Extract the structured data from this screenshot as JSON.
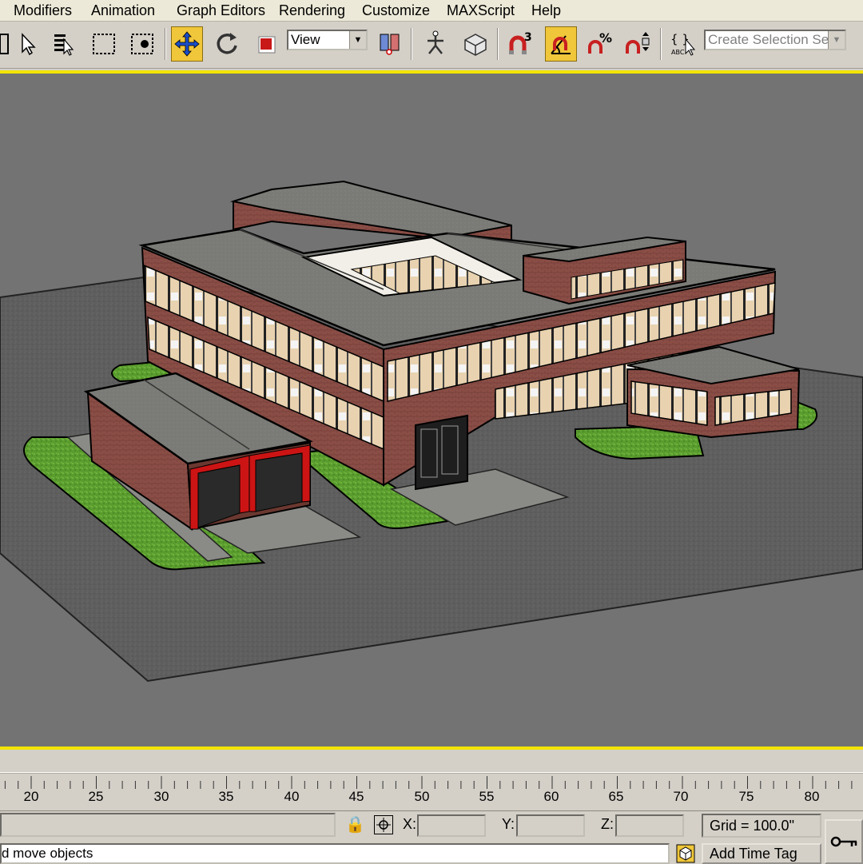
{
  "menu": {
    "items": [
      "Modifiers",
      "Animation",
      "Graph Editors",
      "Rendering",
      "Customize",
      "MAXScript",
      "Help"
    ]
  },
  "toolbar": {
    "reference_coord": "View",
    "named_selection_placeholder": "Create Selection Set",
    "active_tool": "select-and-move",
    "accent_color": "#f0c63a"
  },
  "viewport": {
    "border_color": "#f3e400",
    "background": "#737373"
  },
  "timeline": {
    "ticks": [
      "20",
      "25",
      "30",
      "35",
      "40",
      "45",
      "50",
      "55",
      "60",
      "65",
      "70",
      "75",
      "80"
    ]
  },
  "status": {
    "x_label": "X:",
    "y_label": "Y:",
    "z_label": "Z:",
    "grid_text": "Grid = 100.0\"",
    "prompt_text": "d move objects",
    "add_time_tag": "Add Time Tag"
  }
}
